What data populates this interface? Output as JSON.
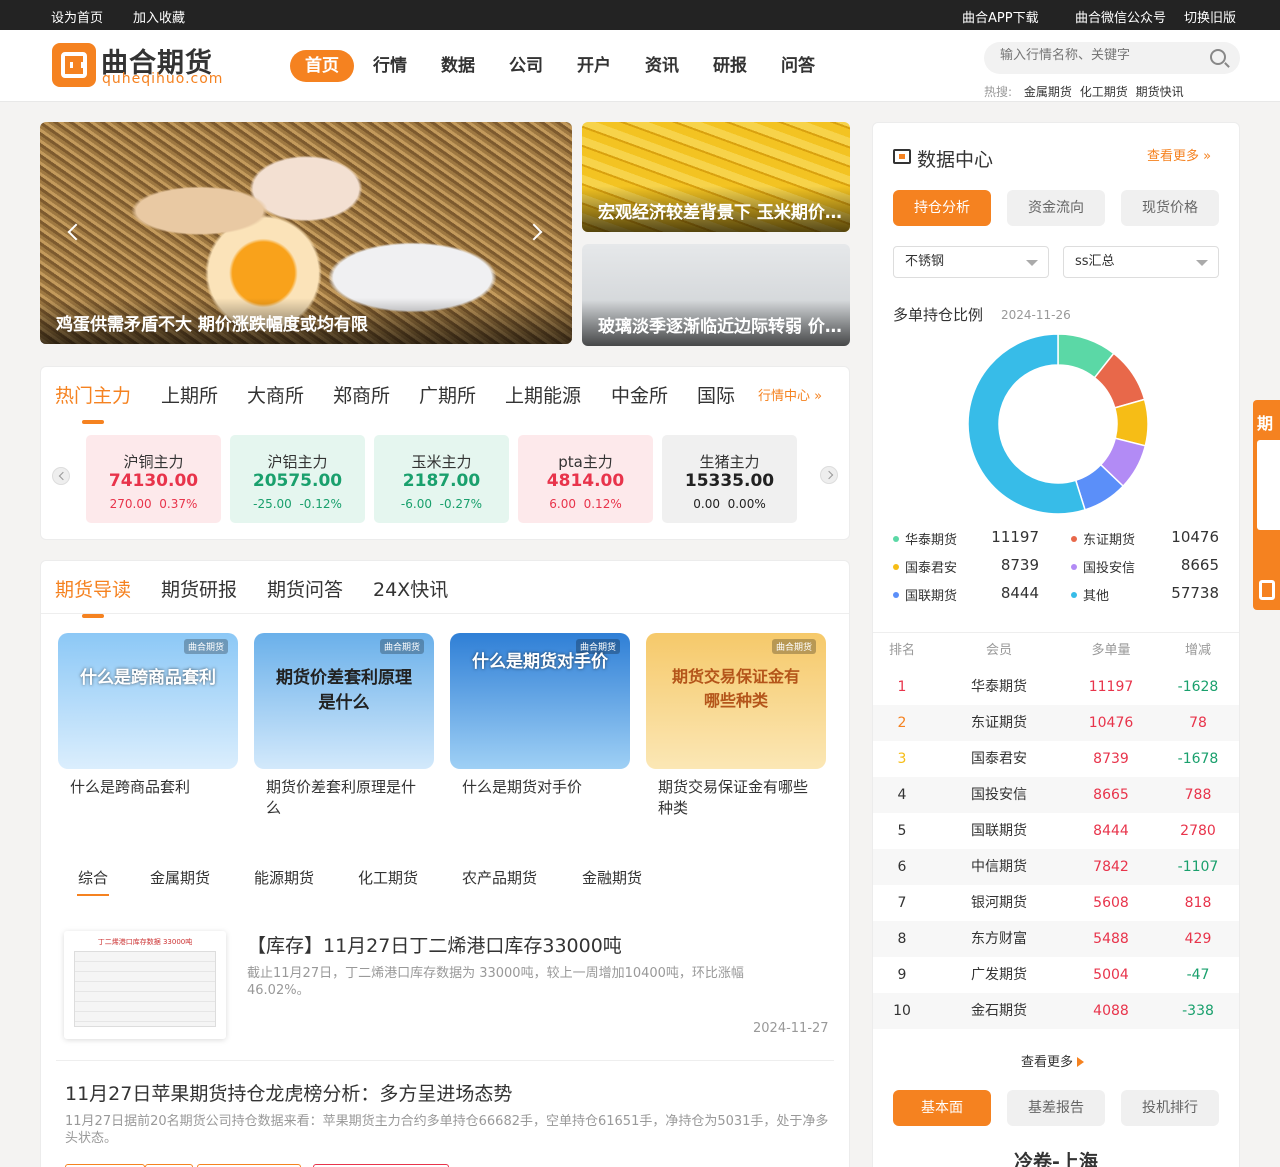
{
  "topbar": {
    "set_home": "设为首页",
    "add_fav": "加入收藏",
    "app_download": "曲合APP下载",
    "wechat": "曲合微信公众号",
    "old_version": "切换旧版"
  },
  "header": {
    "logo_text": "曲合期货",
    "logo_sub": "quheqihuo.com",
    "nav": [
      "首页",
      "行情",
      "数据",
      "公司",
      "开户",
      "资讯",
      "研报",
      "问答"
    ],
    "search_placeholder": "输入行情名称、关键字",
    "hot_label": "热搜:",
    "hot_items": [
      "金属期货",
      "化工期货",
      "期货快讯"
    ]
  },
  "banner": {
    "main_caption": "鸡蛋供需矛盾不大 期价涨跌幅度或均有限",
    "side1_caption": "宏观经济较差背景下 玉米期价上行空间有限",
    "side2_caption": "玻璃淡季逐渐临近边际转弱 价格或偏弱运行"
  },
  "market": {
    "tabs": [
      "热门主力",
      "上期所",
      "大商所",
      "郑商所",
      "广期所",
      "上期能源",
      "中金所",
      "国际"
    ],
    "center_link": "行情中心",
    "cards": [
      {
        "name": "沪铜主力",
        "price": "74130.00",
        "change": "270.00",
        "pct": "0.37%",
        "dir": "up"
      },
      {
        "name": "沪铝主力",
        "price": "20575.00",
        "change": "-25.00",
        "pct": "-0.12%",
        "dir": "down"
      },
      {
        "name": "玉米主力",
        "price": "2187.00",
        "change": "-6.00",
        "pct": "-0.27%",
        "dir": "down"
      },
      {
        "name": "pta主力",
        "price": "4814.00",
        "change": "6.00",
        "pct": "0.12%",
        "dir": "up"
      },
      {
        "name": "生猪主力",
        "price": "15335.00",
        "change": "0.00",
        "pct": "0.00%",
        "dir": "flat"
      }
    ]
  },
  "guide": {
    "tabs": [
      "期货导读",
      "期货研报",
      "期货问答",
      "24X快讯"
    ],
    "thumb_badge": "曲合期货",
    "thumbs": [
      {
        "title": "什么是跨商品套利",
        "caption": "什么是跨商品套利",
        "color": "#6eb3ee"
      },
      {
        "title": "期货价差套利原理是什么",
        "caption": "期货价差套利原理是什么",
        "color": "#5ea3e6"
      },
      {
        "title": "什么是期货对手价",
        "caption": "什么是期货对手价",
        "color": "#3a86d8"
      },
      {
        "title": "期货交易保证金有哪些种类",
        "caption": "期货交易保证金有哪些种类",
        "color": "#f3b95a"
      }
    ],
    "subtabs": [
      "综合",
      "金属期货",
      "能源期货",
      "化工期货",
      "农产品期货",
      "金融期货"
    ],
    "articles": [
      {
        "title": "【库存】11月27日丁二烯港口库存33000吨",
        "summary": "截止11月27日，丁二烯港口库存数据为 33000吨，较上一周增加10400吨，环比涨幅46.02%。",
        "date": "2024-11-27",
        "thumb_title": "丁二烯港口库存数据 33000吨"
      },
      {
        "title": "11月27日苹果期货持仓龙虎榜分析：多方呈进场态势",
        "summary": "11月27日据前20名期货公司持仓数据来看：苹果期货主力合约多单持仓66682手，空单持仓61651手，净持仓为5031手，处于净多头状态。"
      }
    ]
  },
  "data_center": {
    "title": "数据中心",
    "more": "查看更多",
    "tabs": [
      "持仓分析",
      "资金流向",
      "现货价格"
    ],
    "select1": "不锈钢",
    "select2": "ss汇总",
    "ratio_title": "多单持仓比例",
    "ratio_date": "2024-11-26",
    "chart_data": {
      "type": "pie",
      "title": "多单持仓比例",
      "donut": true,
      "series": [
        {
          "name": "华泰期货",
          "value": 11197,
          "color": "#5bd8a6"
        },
        {
          "name": "东证期货",
          "value": 10476,
          "color": "#e8684a"
        },
        {
          "name": "国泰君安",
          "value": 8739,
          "color": "#f6bd16"
        },
        {
          "name": "国投安信",
          "value": 8665,
          "color": "#b28bf5"
        },
        {
          "name": "国联期货",
          "value": 8444,
          "color": "#5b8ff9"
        },
        {
          "name": "其他",
          "value": 57738,
          "color": "#37bce8"
        }
      ]
    },
    "table_headers": [
      "排名",
      "会员",
      "多单量",
      "增减"
    ],
    "rows": [
      {
        "rank": "1",
        "member": "华泰期货",
        "volume": "11197",
        "delta": "-1628"
      },
      {
        "rank": "2",
        "member": "东证期货",
        "volume": "10476",
        "delta": "78"
      },
      {
        "rank": "3",
        "member": "国泰君安",
        "volume": "8739",
        "delta": "-1678"
      },
      {
        "rank": "4",
        "member": "国投安信",
        "volume": "8665",
        "delta": "788"
      },
      {
        "rank": "5",
        "member": "国联期货",
        "volume": "8444",
        "delta": "2780"
      },
      {
        "rank": "6",
        "member": "中信期货",
        "volume": "7842",
        "delta": "-1107"
      },
      {
        "rank": "7",
        "member": "银河期货",
        "volume": "5608",
        "delta": "818"
      },
      {
        "rank": "8",
        "member": "东方财富",
        "volume": "5488",
        "delta": "429"
      },
      {
        "rank": "9",
        "member": "广发期货",
        "volume": "5004",
        "delta": "-47"
      },
      {
        "rank": "10",
        "member": "金石期货",
        "volume": "4088",
        "delta": "-338"
      }
    ],
    "view_more": "查看更多",
    "bottom_tabs": [
      "基本面",
      "基差报告",
      "投机排行"
    ],
    "bottom_title": "冷卷-上海"
  },
  "float_tab": "期"
}
